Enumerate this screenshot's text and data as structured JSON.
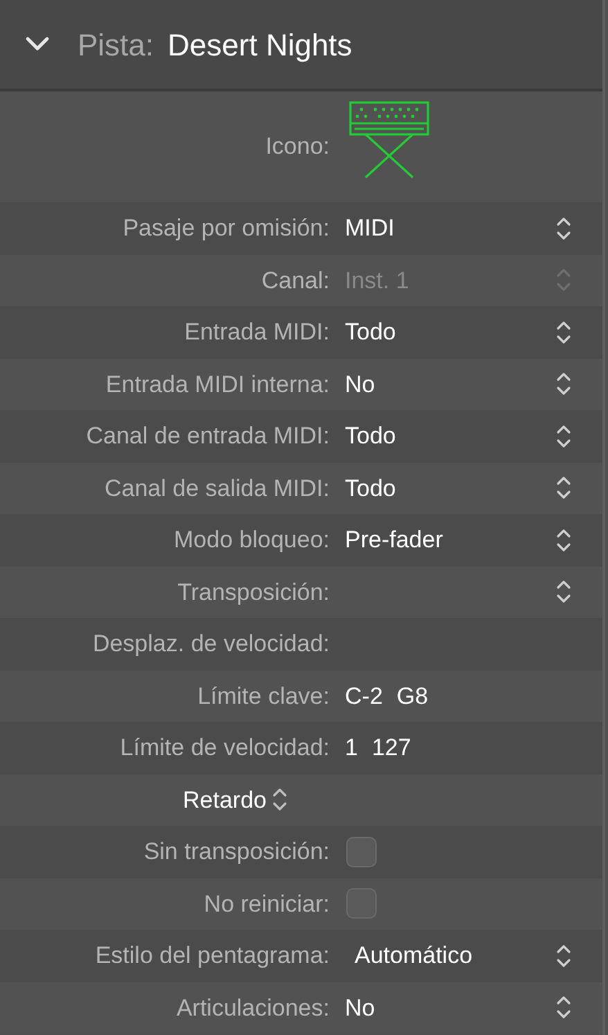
{
  "header": {
    "expanded": true,
    "label": "Pista:",
    "title": "Desert Nights"
  },
  "rows": [
    {
      "kind": "icon",
      "label": "Icono:"
    },
    {
      "kind": "popup",
      "label": "Pasaje por omisión:",
      "value": "MIDI",
      "disabled": false
    },
    {
      "kind": "popup",
      "label": "Canal:",
      "value": "Inst. 1",
      "disabled": true
    },
    {
      "kind": "popup",
      "label": "Entrada MIDI:",
      "value": "Todo",
      "disabled": false
    },
    {
      "kind": "popup",
      "label": "Entrada MIDI interna:",
      "value": "No",
      "disabled": false
    },
    {
      "kind": "popup",
      "label": "Canal de entrada MIDI:",
      "value": "Todo",
      "disabled": false
    },
    {
      "kind": "popup",
      "label": "Canal de salida MIDI:",
      "value": "Todo",
      "disabled": false
    },
    {
      "kind": "popup",
      "label": "Modo bloqueo:",
      "value": "Pre-fader",
      "disabled": false
    },
    {
      "kind": "popup",
      "label": "Transposición:",
      "disabled": false
    },
    {
      "kind": "field",
      "label": "Desplaz. de velocidad:"
    },
    {
      "kind": "range",
      "label": "Límite clave:",
      "values": [
        "C-2",
        "G8"
      ]
    },
    {
      "kind": "range",
      "label": "Límite de velocidad:",
      "values": [
        "1",
        "127"
      ]
    },
    {
      "kind": "menu",
      "label": "Retardo"
    },
    {
      "kind": "checkbox",
      "label": "Sin transposición:",
      "checked": false
    },
    {
      "kind": "checkbox",
      "label": "No reiniciar:",
      "checked": false
    },
    {
      "kind": "popup",
      "label": "Estilo del pentagrama:",
      "value": "Automático",
      "disabled": false,
      "wide": true
    },
    {
      "kind": "popup",
      "label": "Articulaciones:",
      "value": "No",
      "disabled": false
    }
  ]
}
